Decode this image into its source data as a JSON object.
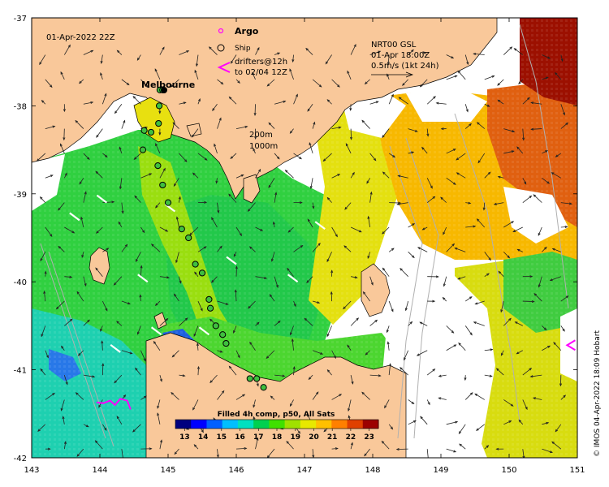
{
  "map": {
    "timestamp": "01-Apr-2022 22Z",
    "city_label": "Melbourne",
    "depth_labels": [
      "200m",
      "1000m"
    ],
    "legend": {
      "argo": "Argo",
      "ship": "Ship",
      "drifters_line1": "drifters@12h",
      "drifters_line2": "to 02/04 12Z"
    },
    "current_key": {
      "line1": "NRT00 GSL",
      "line2": "01-Apr 18:00Z",
      "line3": "0.5m/s (1kt 24h)"
    },
    "credit": "© IMOS 04-Apr-2022 18:09 Hobart",
    "x_axis": {
      "ticks": [
        "143",
        "144",
        "145",
        "146",
        "147",
        "148",
        "149",
        "150",
        "151"
      ],
      "range": [
        143,
        151
      ]
    },
    "y_axis": {
      "ticks": [
        "-37",
        "-38",
        "-39",
        "-40",
        "-41",
        "-42"
      ],
      "range": [
        -42,
        -37
      ]
    },
    "colorbar": {
      "title": "Filled 4h comp, p50, All Sats",
      "ticks": [
        "13",
        "14",
        "15",
        "16",
        "17",
        "18",
        "19",
        "20",
        "21",
        "22",
        "23"
      ],
      "range": [
        12.5,
        23.5
      ],
      "colors": [
        "#00007f",
        "#0000ff",
        "#0060ff",
        "#00bfff",
        "#00e0c0",
        "#00d050",
        "#40e000",
        "#a0e000",
        "#e8e800",
        "#ffc000",
        "#ff8000",
        "#e04000",
        "#9c0000"
      ]
    },
    "colors": {
      "land": "#f9c89a",
      "no_data": "#ffffff",
      "argo": "#ff00ff",
      "drifter": "#ff00ff"
    },
    "ship_positions": [
      [
        144.88,
        -37.82
      ],
      [
        144.92,
        -37.82
      ],
      [
        144.87,
        -38.0
      ],
      [
        144.86,
        -38.2
      ],
      [
        144.65,
        -38.28
      ],
      [
        144.75,
        -38.3
      ],
      [
        144.63,
        -38.5
      ],
      [
        144.85,
        -38.68
      ],
      [
        144.92,
        -38.9
      ],
      [
        145.0,
        -39.1
      ],
      [
        145.2,
        -39.4
      ],
      [
        145.3,
        -39.5
      ],
      [
        145.4,
        -39.8
      ],
      [
        145.5,
        -39.9
      ],
      [
        145.6,
        -40.2
      ],
      [
        145.62,
        -40.3
      ],
      [
        145.7,
        -40.5
      ],
      [
        145.8,
        -40.6
      ],
      [
        145.85,
        -40.7
      ],
      [
        146.2,
        -41.1
      ],
      [
        146.3,
        -41.1
      ],
      [
        146.4,
        -41.2
      ]
    ],
    "drifter_tracks": [
      [
        [
          143.95,
          -41.37
        ],
        [
          144.05,
          -41.38
        ],
        [
          144.15,
          -41.35
        ],
        [
          144.22,
          -41.4
        ],
        [
          144.3,
          -41.33
        ],
        [
          144.4,
          -41.35
        ],
        [
          144.45,
          -41.45
        ]
      ]
    ],
    "drifter_marker": [
      150.85,
      -40.72
    ],
    "argo_legend_symbol": [
      145.78,
      -37.03
    ]
  }
}
